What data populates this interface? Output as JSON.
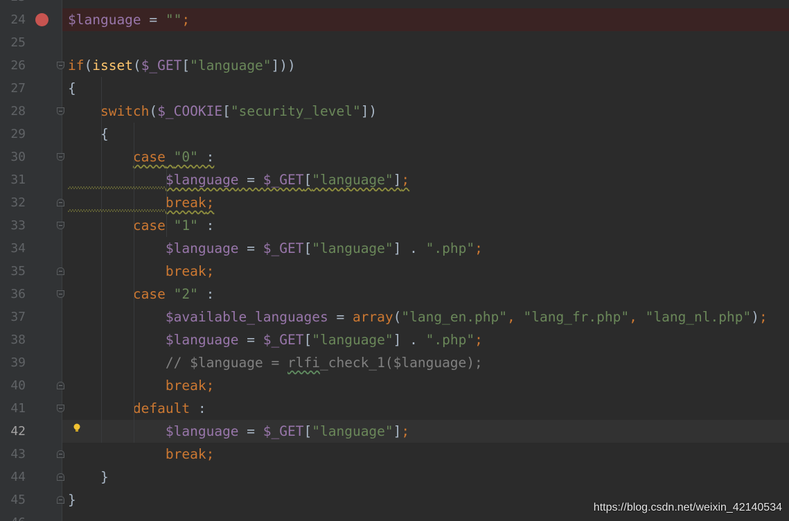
{
  "editor": {
    "watermark": "https://blog.csdn.net/weixin_42140534",
    "current_line": 42,
    "breakpoint_line": 24,
    "lines": [
      {
        "n": "24",
        "tokens": [
          {
            "t": "$language",
            "c": "var"
          },
          {
            "t": " = ",
            "c": ""
          },
          {
            "t": "\"\"",
            "c": "str"
          },
          {
            "t": ";",
            "c": "kw"
          }
        ]
      },
      {
        "n": "25",
        "tokens": []
      },
      {
        "n": "26",
        "tokens": [
          {
            "t": "if",
            "c": "kw"
          },
          {
            "t": "(",
            "c": ""
          },
          {
            "t": "isset",
            "c": "fn"
          },
          {
            "t": "(",
            "c": ""
          },
          {
            "t": "$_GET",
            "c": "var"
          },
          {
            "t": "[",
            "c": ""
          },
          {
            "t": "\"language\"",
            "c": "str"
          },
          {
            "t": "]))",
            "c": ""
          }
        ]
      },
      {
        "n": "27",
        "tokens": [
          {
            "t": "{",
            "c": ""
          }
        ]
      },
      {
        "n": "28",
        "tokens": [
          {
            "t": "    ",
            "c": ""
          },
          {
            "t": "switch",
            "c": "kw"
          },
          {
            "t": "(",
            "c": ""
          },
          {
            "t": "$_COOKIE",
            "c": "var"
          },
          {
            "t": "[",
            "c": ""
          },
          {
            "t": "\"security_level\"",
            "c": "str"
          },
          {
            "t": "])",
            "c": ""
          }
        ]
      },
      {
        "n": "29",
        "tokens": [
          {
            "t": "    {",
            "c": ""
          }
        ]
      },
      {
        "n": "30",
        "tokens": [
          {
            "t": "        ",
            "c": ""
          },
          {
            "t": "case",
            "c": "kw sq"
          },
          {
            "t": " ",
            "c": "sq"
          },
          {
            "t": "\"0\"",
            "c": "str sq"
          },
          {
            "t": " :",
            "c": "sq"
          }
        ]
      },
      {
        "n": "31",
        "tokens": [
          {
            "t": "            ",
            "c": ""
          },
          {
            "t": "$language",
            "c": "var sq"
          },
          {
            "t": " = ",
            "c": "sq"
          },
          {
            "t": "$_GET",
            "c": "var sq"
          },
          {
            "t": "[",
            "c": "sq"
          },
          {
            "t": "\"language\"",
            "c": "str sq"
          },
          {
            "t": "]",
            "c": "sq"
          },
          {
            "t": ";",
            "c": "kw sq"
          }
        ]
      },
      {
        "n": "32",
        "tokens": [
          {
            "t": "            ",
            "c": ""
          },
          {
            "t": "break",
            "c": "kw sq"
          },
          {
            "t": ";",
            "c": "kw sq"
          }
        ]
      },
      {
        "n": "33",
        "tokens": [
          {
            "t": "        ",
            "c": ""
          },
          {
            "t": "case",
            "c": "kw"
          },
          {
            "t": " ",
            "c": ""
          },
          {
            "t": "\"1\"",
            "c": "str"
          },
          {
            "t": " :",
            "c": ""
          }
        ]
      },
      {
        "n": "34",
        "tokens": [
          {
            "t": "            ",
            "c": ""
          },
          {
            "t": "$language",
            "c": "var"
          },
          {
            "t": " = ",
            "c": ""
          },
          {
            "t": "$_GET",
            "c": "var"
          },
          {
            "t": "[",
            "c": ""
          },
          {
            "t": "\"language\"",
            "c": "str"
          },
          {
            "t": "] . ",
            "c": ""
          },
          {
            "t": "\".php\"",
            "c": "str"
          },
          {
            "t": ";",
            "c": "kw"
          }
        ]
      },
      {
        "n": "35",
        "tokens": [
          {
            "t": "            ",
            "c": ""
          },
          {
            "t": "break",
            "c": "kw"
          },
          {
            "t": ";",
            "c": "kw"
          }
        ]
      },
      {
        "n": "36",
        "tokens": [
          {
            "t": "        ",
            "c": ""
          },
          {
            "t": "case",
            "c": "kw"
          },
          {
            "t": " ",
            "c": ""
          },
          {
            "t": "\"2\"",
            "c": "str"
          },
          {
            "t": " :",
            "c": ""
          }
        ]
      },
      {
        "n": "37",
        "tokens": [
          {
            "t": "            ",
            "c": ""
          },
          {
            "t": "$available_languages",
            "c": "var"
          },
          {
            "t": " = ",
            "c": ""
          },
          {
            "t": "array",
            "c": "kw"
          },
          {
            "t": "(",
            "c": ""
          },
          {
            "t": "\"lang_en.php\"",
            "c": "str"
          },
          {
            "t": ", ",
            "c": "kw"
          },
          {
            "t": "\"lang_fr.php\"",
            "c": "str"
          },
          {
            "t": ", ",
            "c": "kw"
          },
          {
            "t": "\"lang_nl.php\"",
            "c": "str"
          },
          {
            "t": ")",
            "c": ""
          },
          {
            "t": ";",
            "c": "kw"
          }
        ]
      },
      {
        "n": "38",
        "tokens": [
          {
            "t": "            ",
            "c": ""
          },
          {
            "t": "$language",
            "c": "var"
          },
          {
            "t": " = ",
            "c": ""
          },
          {
            "t": "$_GET",
            "c": "var"
          },
          {
            "t": "[",
            "c": ""
          },
          {
            "t": "\"language\"",
            "c": "str"
          },
          {
            "t": "] . ",
            "c": ""
          },
          {
            "t": "\".php\"",
            "c": "str"
          },
          {
            "t": ";",
            "c": "kw"
          }
        ]
      },
      {
        "n": "39",
        "tokens": [
          {
            "t": "            ",
            "c": ""
          },
          {
            "t": "// $language = ",
            "c": "cmt"
          },
          {
            "t": "rlfi",
            "c": "cmt sqg"
          },
          {
            "t": "_check_1($language);",
            "c": "cmt"
          }
        ]
      },
      {
        "n": "40",
        "tokens": [
          {
            "t": "            ",
            "c": ""
          },
          {
            "t": "break",
            "c": "kw"
          },
          {
            "t": ";",
            "c": "kw"
          }
        ]
      },
      {
        "n": "41",
        "tokens": [
          {
            "t": "        ",
            "c": ""
          },
          {
            "t": "default",
            "c": "kw"
          },
          {
            "t": " :",
            "c": ""
          }
        ]
      },
      {
        "n": "42",
        "tokens": [
          {
            "t": "            ",
            "c": ""
          },
          {
            "t": "$language",
            "c": "var"
          },
          {
            "t": " = ",
            "c": ""
          },
          {
            "t": "$_GET",
            "c": "var"
          },
          {
            "t": "[",
            "c": ""
          },
          {
            "t": "\"language\"",
            "c": "str"
          },
          {
            "t": "]",
            "c": ""
          },
          {
            "t": ";",
            "c": "kw"
          }
        ]
      },
      {
        "n": "43",
        "tokens": [
          {
            "t": "            ",
            "c": ""
          },
          {
            "t": "break",
            "c": "kw"
          },
          {
            "t": ";",
            "c": "kw"
          }
        ]
      },
      {
        "n": "44",
        "tokens": [
          {
            "t": "    }",
            "c": ""
          }
        ]
      },
      {
        "n": "45",
        "tokens": [
          {
            "t": "}",
            "c": ""
          }
        ]
      }
    ],
    "folds": [
      {
        "line": "26",
        "kind": "open"
      },
      {
        "line": "28",
        "kind": "open"
      },
      {
        "line": "30",
        "kind": "open"
      },
      {
        "line": "32",
        "kind": "close"
      },
      {
        "line": "33",
        "kind": "open"
      },
      {
        "line": "35",
        "kind": "close"
      },
      {
        "line": "36",
        "kind": "open"
      },
      {
        "line": "40",
        "kind": "close"
      },
      {
        "line": "41",
        "kind": "open"
      },
      {
        "line": "43",
        "kind": "close"
      },
      {
        "line": "44",
        "kind": "close"
      },
      {
        "line": "45",
        "kind": "close"
      }
    ]
  }
}
